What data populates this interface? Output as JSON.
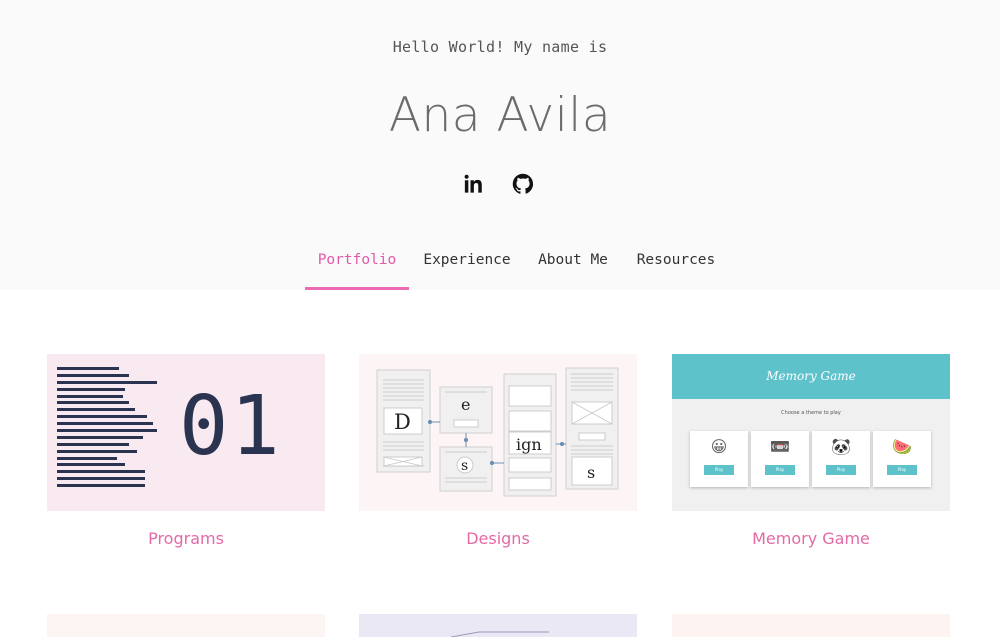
{
  "header": {
    "greeting": "Hello World! My name is",
    "name": "Ana Avila",
    "socials": [
      {
        "icon": "linkedin-icon"
      },
      {
        "icon": "github-icon"
      }
    ]
  },
  "nav": {
    "tabs": [
      {
        "label": "Portfolio",
        "active": true
      },
      {
        "label": "Experience",
        "active": false
      },
      {
        "label": "About Me",
        "active": false
      },
      {
        "label": "Resources",
        "active": false
      }
    ]
  },
  "projects": [
    {
      "title": "Programs",
      "thumb_text": "01"
    },
    {
      "title": "Designs",
      "thumb_letters": [
        "D",
        "e",
        "s",
        "ign",
        "s"
      ]
    },
    {
      "title": "Memory Game",
      "thumb": {
        "heading": "Memory Game",
        "subtitle": "Choose a theme to play",
        "button": "Play",
        "emojis": [
          "😀",
          "📼",
          "🐼",
          "🍉"
        ]
      }
    }
  ],
  "colors": {
    "accent": "#ea6bb4",
    "card_title": "#e36aa6",
    "header_bg": "#fafafa",
    "programs_bg": "#f9e9f0",
    "designs_bg": "#fdf5f5",
    "memory_bar": "#5ec2cb"
  }
}
